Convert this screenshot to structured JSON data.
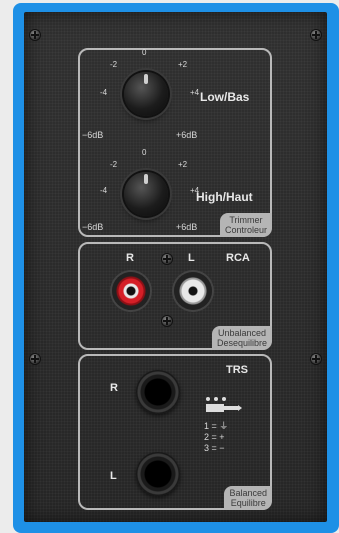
{
  "eq": {
    "low": {
      "name": "Low/Bas",
      "scale_center": "0",
      "scale_left_minor": "-2",
      "scale_right_minor": "+2",
      "scale_left_mid": "-4",
      "scale_right_mid": "+4",
      "min": "−6dB",
      "max": "+6dB"
    },
    "high": {
      "name": "High/Haut",
      "scale_center": "0",
      "scale_left_minor": "-2",
      "scale_right_minor": "+2",
      "scale_left_mid": "-4",
      "scale_right_mid": "+4",
      "min": "−6dB",
      "max": "+6dB"
    },
    "caption": [
      "Trimmer",
      "Controleur"
    ]
  },
  "rca": {
    "title": "RCA",
    "right": "R",
    "left": "L",
    "caption": [
      "Unbalanced",
      "Desequilibre"
    ]
  },
  "trs": {
    "title": "TRS",
    "right": "R",
    "left": "L",
    "legend": [
      "1 = ⏚",
      "2 = +",
      "3 = −"
    ],
    "caption": [
      "Balanced",
      "Equilibre"
    ]
  },
  "colors": {
    "frame": "#1e90e6",
    "panel": "#2b2b2b",
    "rca_right": "#d51f27",
    "rca_left": "#e8e8e8"
  }
}
